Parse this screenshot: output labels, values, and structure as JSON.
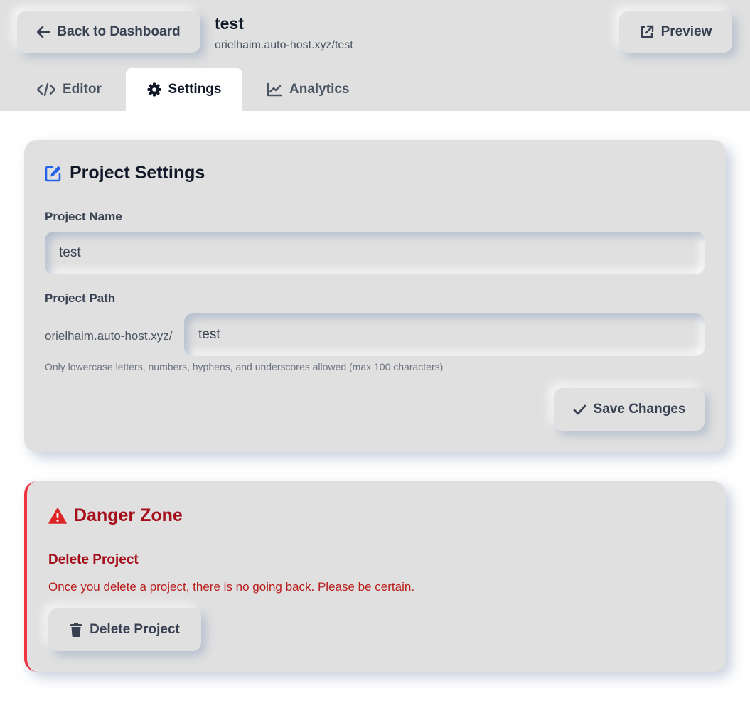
{
  "header": {
    "back_label": "Back to Dashboard",
    "project_title": "test",
    "project_url": "orielhaim.auto-host.xyz/test",
    "preview_label": "Preview"
  },
  "tabs": [
    {
      "label": "Editor",
      "icon": "code-icon"
    },
    {
      "label": "Settings",
      "icon": "gear-icon",
      "active": true
    },
    {
      "label": "Analytics",
      "icon": "chart-line-icon"
    }
  ],
  "settings": {
    "title": "Project Settings",
    "name_label": "Project Name",
    "name_value": "test",
    "path_label": "Project Path",
    "path_prefix": "orielhaim.auto-host.xyz/",
    "path_value": "test",
    "hint": "Only lowercase letters, numbers, hyphens, and underscores allowed (max 100 characters)",
    "save_label": "Save Changes"
  },
  "danger": {
    "title": "Danger Zone",
    "subtitle": "Delete Project",
    "text": "Once you delete a project, there is no going back. Please be certain.",
    "delete_label": "Delete Project"
  },
  "colors": {
    "accent": "#2563eb",
    "danger": "#a50e1b",
    "danger_border": "#ef3340",
    "surface": "#e0e0e0"
  }
}
